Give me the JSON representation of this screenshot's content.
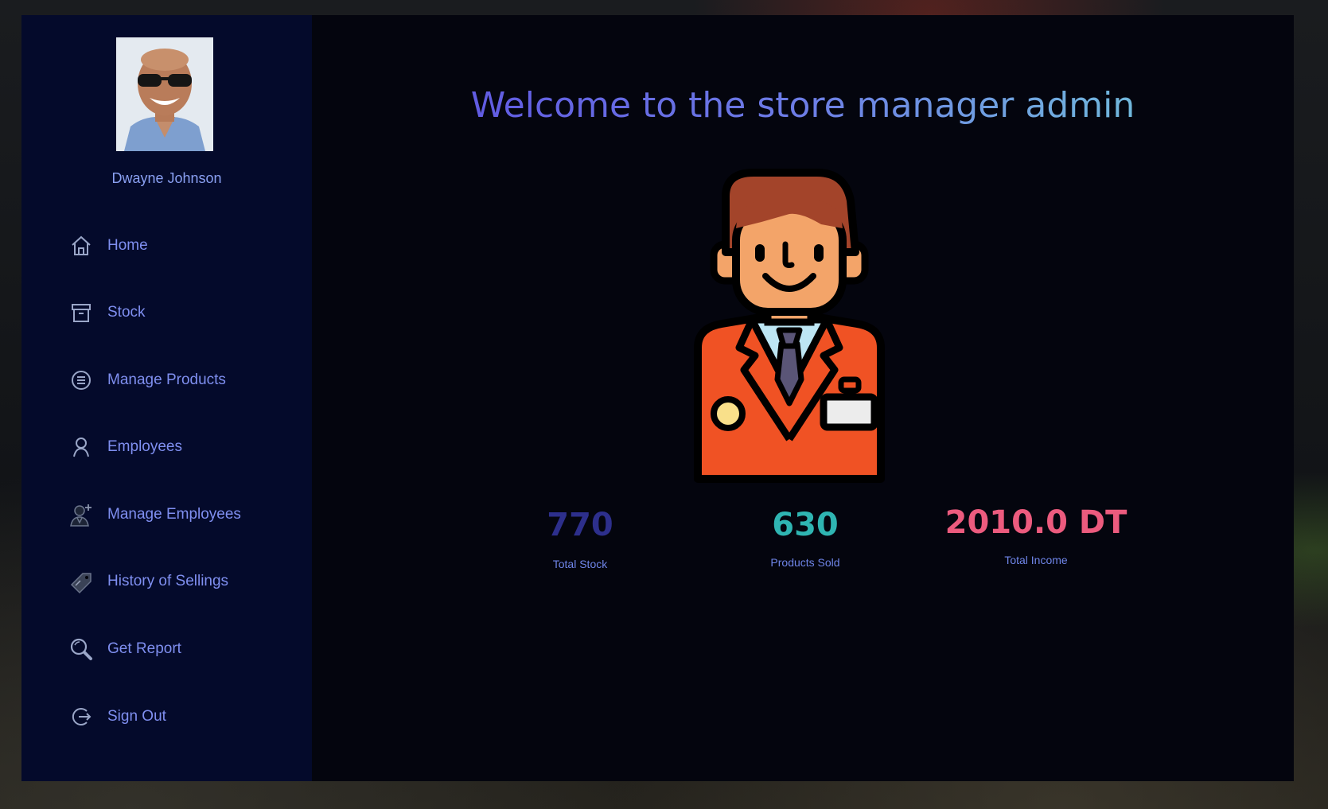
{
  "user": {
    "name": "Dwayne Johnson"
  },
  "sidebar": {
    "items": [
      {
        "label": "Home",
        "icon": "home-icon"
      },
      {
        "label": "Stock",
        "icon": "archive-box-icon"
      },
      {
        "label": "Manage Products",
        "icon": "list-circle-icon"
      },
      {
        "label": "Employees",
        "icon": "person-icon"
      },
      {
        "label": "Manage Employees",
        "icon": "add-employee-icon"
      },
      {
        "label": "History of Sellings",
        "icon": "sale-tag-icon"
      },
      {
        "label": "Get Report",
        "icon": "magnifier-icon"
      },
      {
        "label": "Sign Out",
        "icon": "sign-out-icon"
      }
    ]
  },
  "main": {
    "title": "Welcome to the store manager admin",
    "hero_icon": "store-manager-illustration",
    "stats": [
      {
        "value": "770",
        "label": "Total Stock",
        "color": "#2d2f8c"
      },
      {
        "value": "630",
        "label": "Products Sold",
        "color": "#2fb5b2"
      },
      {
        "value": "2010.0 DT",
        "label": "Total Income",
        "color": "#ec5b7e"
      }
    ]
  },
  "colors": {
    "window_bg": "#04050e",
    "sidebar_bg": "#040a2b",
    "nav_text": "#7f8ff0"
  }
}
